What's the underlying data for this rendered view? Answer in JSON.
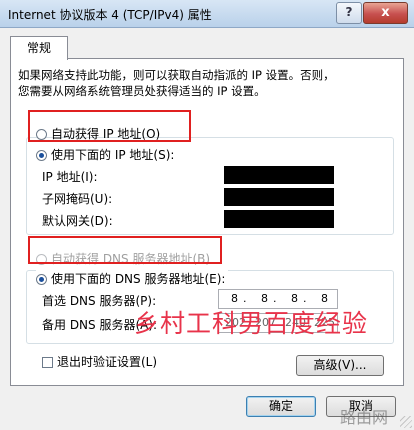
{
  "window": {
    "title": "Internet 协议版本 4 (TCP/IPv4) 属性",
    "help_label": "?",
    "close_label": "x"
  },
  "tabs": [
    "常规"
  ],
  "description": {
    "line1": "如果网络支持此功能，则可以获取自动指派的 IP 设置。否则，",
    "line2": "您需要从网络系统管理员处获得适当的 IP 设置。"
  },
  "ip_section": {
    "auto_label": "自动获得 IP 地址(O)",
    "manual_label": "使用下面的 IP 地址(S):",
    "selected": "manual",
    "fields": [
      {
        "label": "IP 地址(I):",
        "value": "",
        "redacted": true
      },
      {
        "label": "子网掩码(U):",
        "value": "",
        "redacted": true
      },
      {
        "label": "默认网关(D):",
        "value": "",
        "redacted": true
      }
    ]
  },
  "dns_section": {
    "auto_label": "自动获得 DNS 服务器地址(B)",
    "auto_disabled": true,
    "manual_label": "使用下面的 DNS 服务器地址(E):",
    "selected": "manual",
    "preferred_label": "首选 DNS 服务器(P):",
    "preferred_octets": [
      "8",
      "8",
      "8",
      "8"
    ],
    "alternate_label": "备用 DNS 服务器(A):",
    "alternate_octets": [
      "202",
      "207",
      "240",
      "225"
    ]
  },
  "footer": {
    "validate_label": "退出时验证设置(L)",
    "validate_checked": false,
    "advanced_label": "高级(V)...",
    "ok_label": "确定",
    "cancel_label": "取消"
  },
  "overlay": {
    "text": "乡村工科男百度经验"
  },
  "watermark": {
    "text": "路由网"
  },
  "colors": {
    "annotation_red": "#e02020",
    "overlay_text": "#e8334a",
    "radio_fill": "#1a4f9c"
  }
}
